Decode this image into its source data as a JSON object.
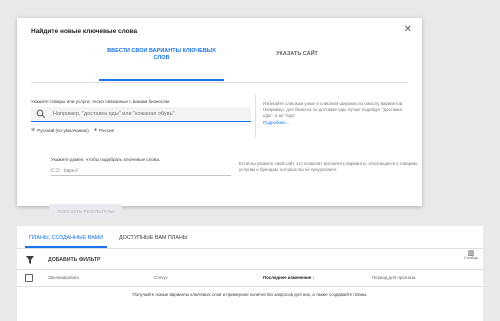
{
  "modal": {
    "title": "Найдите новые ключевые слова",
    "tabs": [
      {
        "label": "ВВЕСТИ СВОИ ВАРИАНТЫ КЛЮЧЕВЫХ СЛОВ",
        "active": true
      },
      {
        "label": "УКАЗАТЬ САЙТ",
        "active": false
      }
    ],
    "keywords_label": "Укажите товары или услуги, тесно связанные с вашим бизнесом.",
    "search_placeholder": "Например, \"доставка еды\" или \"кожаная обувь\".",
    "language": "Русский (по умолчанию)",
    "location": "Россия",
    "hint_keywords": "Избегайте слишком узких и слишком широких по смыслу вариантов. Например, для бизнеса по доставке еды лучше подойдет \"доставка еды\", а не \"еда\".",
    "hint_link": "Подробнее...",
    "domain_label": "Укажите домен, чтобы подобрать ключевые слова.",
    "url_placeholder": "https://",
    "hint_domain": "Если вы укажете свой сайт, это позволит исключить варианты, относящиеся к товарам, услугам и брендам, которые вы не предлагаете.",
    "show_results": "ПОКАЗАТЬ РЕЗУЛЬТАТЫ"
  },
  "plans": {
    "tabs": [
      {
        "label": "ПЛАНЫ, СОЗДАННЫЕ ВАМИ",
        "active": true
      },
      {
        "label": "ДОСТУПНЫЕ ВАМ ПЛАНЫ",
        "active": false
      }
    ],
    "add_filter": "ДОБАВИТЬ ФИЛЬТР",
    "columns_label": "Столбцы",
    "headers": [
      "Запланировать",
      "Статус",
      "Последнее изменение",
      "Период для прогноза"
    ],
    "sort_indicator": "↓",
    "empty_message": "Получайте новые варианты ключевых слов и примерное количество запросов для них, а также создавайте планы."
  },
  "colors": {
    "accent": "#1a73e8"
  }
}
